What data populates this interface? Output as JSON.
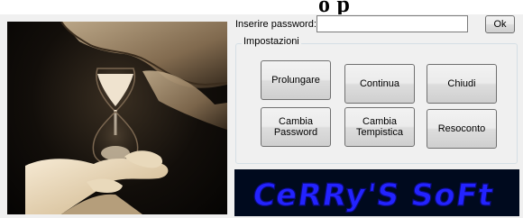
{
  "password": {
    "label": "Inserire password:",
    "value": "",
    "ok_label": "Ok"
  },
  "settings": {
    "group_label": "Impostazioni",
    "buttons": [
      "Prolungare",
      "Continua",
      "Chiudi",
      "Cambia\nPassword",
      "Cambia\nTempistica",
      "Resoconto"
    ]
  },
  "logo": {
    "text": "CeRRy'S SoFt"
  },
  "colors": {
    "logo_text": "#2323ff",
    "logo_background": "#000a1e",
    "window_background": "#f0f0f0"
  }
}
